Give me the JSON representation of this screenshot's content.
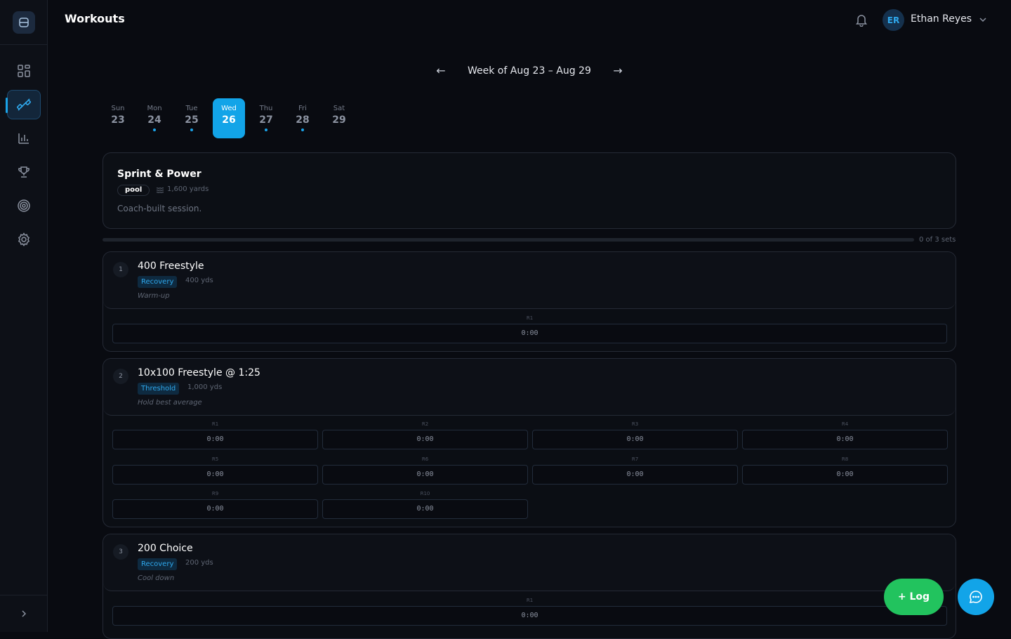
{
  "header": {
    "title": "Workouts",
    "user": {
      "initials": "ER",
      "name": "Ethan Reyes"
    }
  },
  "sidebar": {
    "items": [
      {
        "name": "dashboard-icon",
        "active": false
      },
      {
        "name": "workouts-icon",
        "active": true
      },
      {
        "name": "analytics-icon",
        "active": false
      },
      {
        "name": "trophy-icon",
        "active": false
      },
      {
        "name": "target-icon",
        "active": false
      },
      {
        "name": "settings-icon",
        "active": false
      }
    ]
  },
  "week": {
    "prev": "←",
    "label": "Week of Aug 23 – Aug 29",
    "next": "→",
    "days": [
      {
        "name": "Sun",
        "num": "23",
        "dot": false,
        "selected": false
      },
      {
        "name": "Mon",
        "num": "24",
        "dot": true,
        "selected": false
      },
      {
        "name": "Tue",
        "num": "25",
        "dot": true,
        "selected": false
      },
      {
        "name": "Wed",
        "num": "26",
        "dot": false,
        "selected": true
      },
      {
        "name": "Thu",
        "num": "27",
        "dot": true,
        "selected": false
      },
      {
        "name": "Fri",
        "num": "28",
        "dot": true,
        "selected": false
      },
      {
        "name": "Sat",
        "num": "29",
        "dot": false,
        "selected": false
      }
    ]
  },
  "workout": {
    "title": "Sprint & Power",
    "tag": "pool",
    "distance": "1,600 yards",
    "note": "Coach-built session."
  },
  "progress": {
    "label": "0 of 3 sets",
    "fraction": 0
  },
  "blocks": [
    {
      "num": "1",
      "name": "400 Freestyle",
      "zone": "Recovery",
      "yds": "400 yds",
      "note": "Warm-up",
      "reps": [
        {
          "label": "R1",
          "time": "0:00"
        }
      ]
    },
    {
      "num": "2",
      "name": "10x100 Freestyle @ 1:25",
      "zone": "Threshold",
      "yds": "1,000 yds",
      "note": "Hold best average",
      "reps": [
        {
          "label": "R1",
          "time": "0:00"
        },
        {
          "label": "R2",
          "time": "0:00"
        },
        {
          "label": "R3",
          "time": "0:00"
        },
        {
          "label": "R4",
          "time": "0:00"
        },
        {
          "label": "R5",
          "time": "0:00"
        },
        {
          "label": "R6",
          "time": "0:00"
        },
        {
          "label": "R7",
          "time": "0:00"
        },
        {
          "label": "R8",
          "time": "0:00"
        },
        {
          "label": "R9",
          "time": "0:00"
        },
        {
          "label": "R10",
          "time": "0:00"
        }
      ]
    },
    {
      "num": "3",
      "name": "200 Choice",
      "zone": "Recovery",
      "yds": "200 yds",
      "note": "Cool down",
      "reps": [
        {
          "label": "R1",
          "time": "0:00"
        }
      ]
    }
  ],
  "actions": {
    "log": "+ Log",
    "chat_icon": "chat-icon"
  }
}
